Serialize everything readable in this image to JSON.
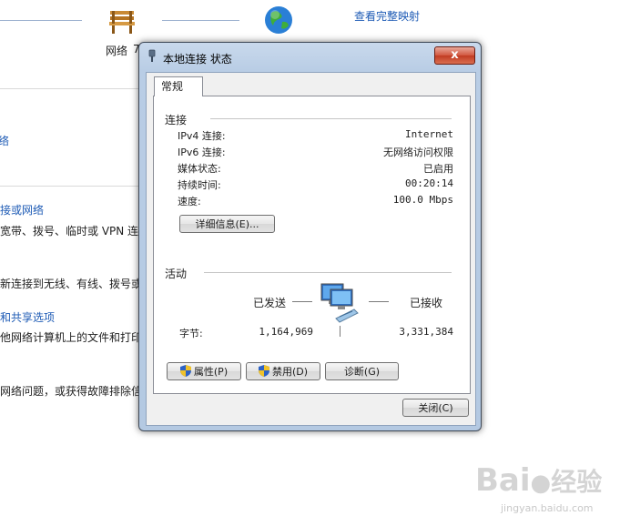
{
  "background": {
    "top_link": "查看完整映射",
    "network_label": "网络",
    "network_label_suffix": "7",
    "left_links": [
      "络",
      "接或网络",
      "和共享选项"
    ],
    "left_texts": [
      "宽带、拨号、临时或 VPN 连接",
      "新连接到无线、有线、拨号或",
      "他网络计算机上的文件和打印",
      "网络问题，或获得故障排除信"
    ]
  },
  "dialog": {
    "title": "本地连接 状态",
    "close_glyph": "x",
    "tab_label": "常规",
    "connection": {
      "heading": "连接",
      "rows": [
        {
          "label": "IPv4 连接:",
          "value": "Internet"
        },
        {
          "label": "IPv6 连接:",
          "value": "无网络访问权限"
        },
        {
          "label": "媒体状态:",
          "value": "已启用"
        },
        {
          "label": "持续时间:",
          "value": "00:20:14"
        },
        {
          "label": "速度:",
          "value": "100.0 Mbps"
        }
      ],
      "details_button": "详细信息(E)..."
    },
    "activity": {
      "heading": "活动",
      "sent_label": "已发送",
      "received_label": "已接收",
      "bytes_label": "字节:",
      "bytes_sent": "1,164,969",
      "bytes_received": "3,331,384"
    },
    "buttons": {
      "properties": "属性(P)",
      "disable": "禁用(D)",
      "diagnose": "诊断(G)",
      "close": "关闭(C)"
    }
  },
  "watermark": {
    "brand": "Bai",
    "brand_cn": "经验",
    "url": "jingyan.baidu.com"
  }
}
